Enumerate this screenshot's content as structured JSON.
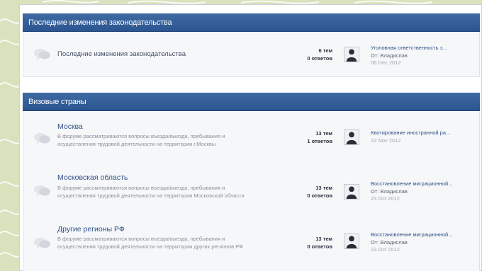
{
  "categories": [
    {
      "title": "Последние изменения законодательства",
      "forums": [
        {
          "title": "Последние изменения законодательства",
          "description": "",
          "topics": "6 тем",
          "replies": "0 ответов",
          "last_post": {
            "title": "Уголовная ответственность з...",
            "author": "От: Владислав",
            "date": "06 Dec 2012"
          }
        }
      ]
    },
    {
      "title": "Визовые страны",
      "forums": [
        {
          "title": "Москва",
          "description": "В форуме рассматриваются вопросы въезда/выезда, пребывания и осуществления трудовой деятельности на территории г.Москвы",
          "topics": "13 тем",
          "replies": "1 ответов",
          "last_post": {
            "title": "Квотирование иностранной ра...",
            "author": "",
            "date": "22 Nov 2012"
          }
        },
        {
          "title": "Московская область",
          "description": "В форуме рассматриваются вопросы въезда/выезда, пребывания и осуществления трудовой деятельности на территории Московской области",
          "topics": "13 тем",
          "replies": "0 ответов",
          "last_post": {
            "title": "Восстановление миграционной...",
            "author": "От: Владислав",
            "date": "23 Oct 2012"
          }
        },
        {
          "title": "Другие регионы РФ",
          "description": "В форуме рассматриваются вопросы въезда/выезда, пребывания и осуществления трудовой деятельности на территории других регионов РФ",
          "topics": "13 тем",
          "replies": "0 ответов",
          "last_post": {
            "title": "Восстановление миграционной...",
            "author": "От: Владислав",
            "date": "23 Oct 2012"
          }
        }
      ]
    }
  ],
  "icons": {
    "forum": "speech-bubble-icon",
    "avatar": "user-avatar-icon"
  },
  "colors": {
    "header": "#2b5590",
    "link": "#2e4f86",
    "background": "#d9e2bd"
  }
}
